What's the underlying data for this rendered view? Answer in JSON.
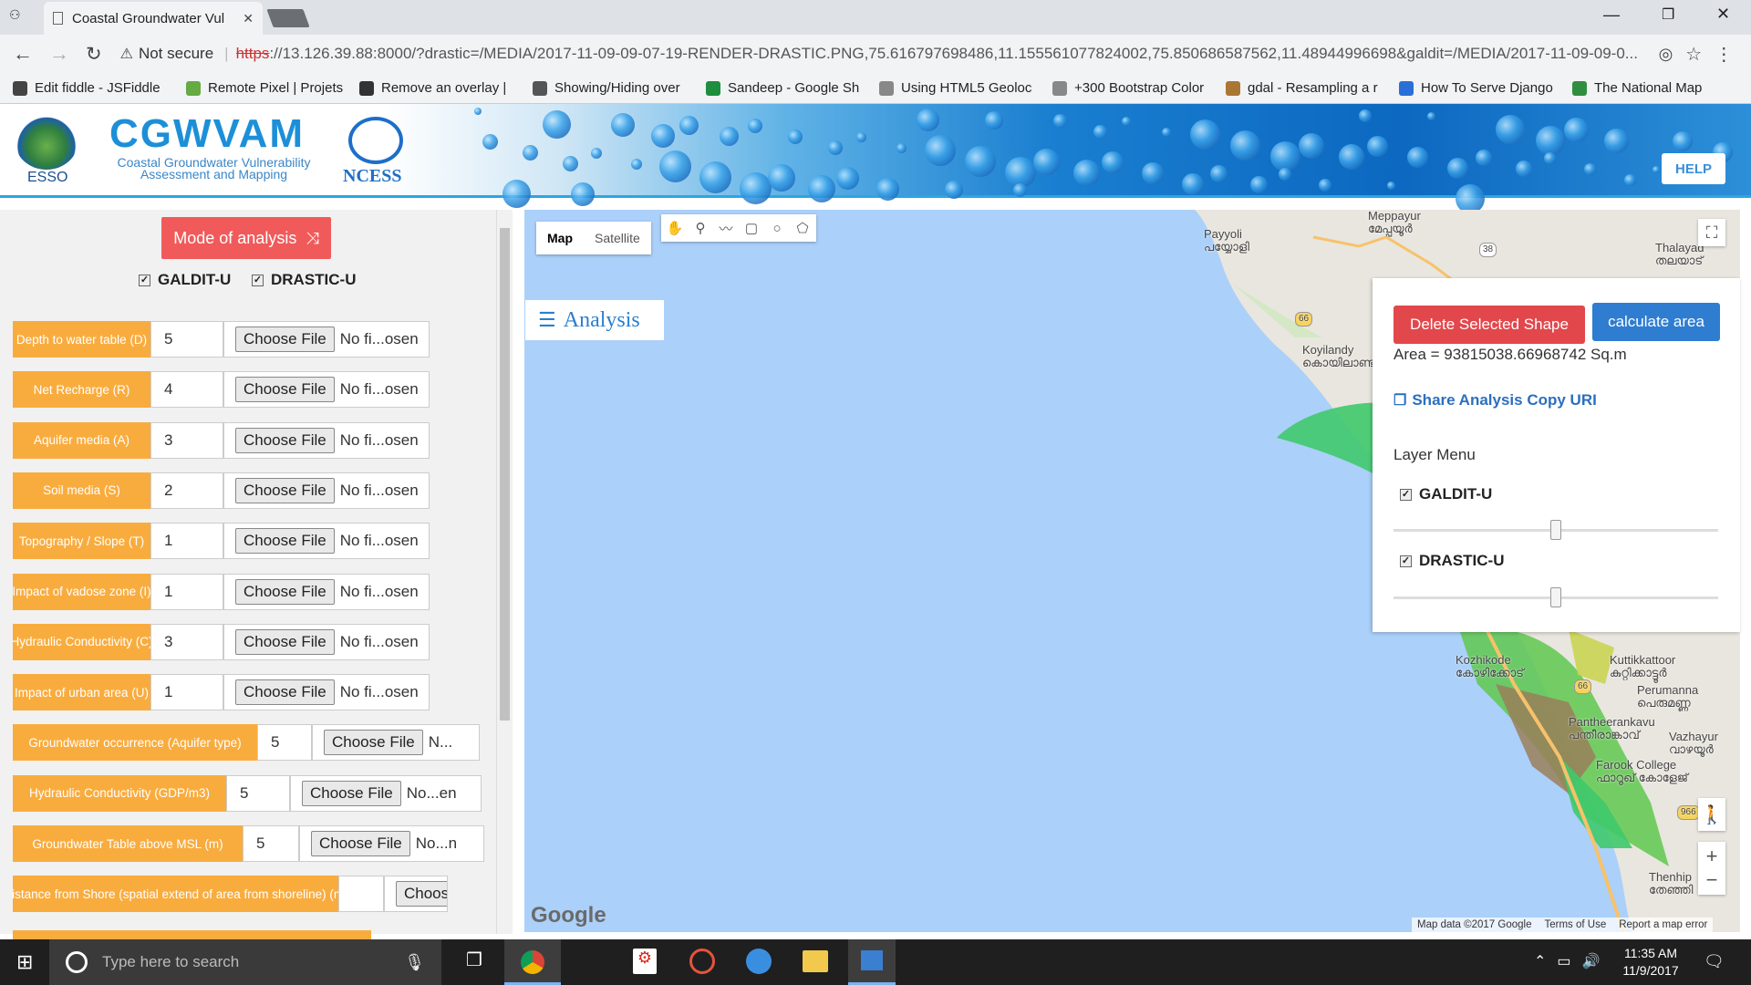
{
  "browser": {
    "tab_title": "Coastal Groundwater Vul",
    "security": "Not secure",
    "url_scheme": "https",
    "url_rest": "://13.126.39.88:8000/?drastic=/MEDIA/2017-11-09-09-07-19-RENDER-DRASTIC.PNG,75.616797698486,11.155561077824002,75.850686587562,11.48944996698&galdit=/MEDIA/2017-11-09-09-0...",
    "bookmarks": [
      {
        "label": "Edit fiddle - JSFiddle",
        "color": "#444"
      },
      {
        "label": "Remote Pixel | Projets",
        "color": "#6a4"
      },
      {
        "label": "Remove an overlay |",
        "color": "#333"
      },
      {
        "label": "Showing/Hiding over",
        "color": "#555"
      },
      {
        "label": "Sandeep - Google Sh",
        "color": "#1e8e3e"
      },
      {
        "label": "Using HTML5 Geoloc",
        "color": "#888"
      },
      {
        "label": "+300 Bootstrap Color",
        "color": "#888"
      },
      {
        "label": "gdal - Resampling a r",
        "color": "#aa7733"
      },
      {
        "label": "How To Serve Django",
        "color": "#2a6fd6"
      },
      {
        "label": "The National Map",
        "color": "#2f8f3f"
      }
    ]
  },
  "header": {
    "esso": "ESSO",
    "title": "CGWVAM",
    "subtitle1": "Coastal Groundwater Vulnerability",
    "subtitle2": "Assessment and Mapping",
    "ncess": "NCESS",
    "help": "HELP"
  },
  "left_panel": {
    "mode_button": "Mode of analysis",
    "check_galdit": "GALDIT-U",
    "check_drastic": "DRASTIC-U",
    "choose_file": "Choose File",
    "rows": [
      {
        "label": "Depth to water table (D)",
        "value": "5",
        "file": "No fi...osen"
      },
      {
        "label": "Net Recharge (R)",
        "value": "4",
        "file": "No fi...osen"
      },
      {
        "label": "Aquifer media (A)",
        "value": "3",
        "file": "No fi...osen"
      },
      {
        "label": "Soil media (S)",
        "value": "2",
        "file": "No fi...osen"
      },
      {
        "label": "Topography / Slope (T)",
        "value": "1",
        "file": "No fi...osen"
      },
      {
        "label": "Impact of vadose zone (I)",
        "value": "1",
        "file": "No fi...osen"
      },
      {
        "label": "Hydraulic Conductivity (C)",
        "value": "3",
        "file": "No fi...osen"
      },
      {
        "label": "Impact of urban area (U)",
        "value": "1",
        "file": "No fi...osen"
      },
      {
        "label": "Groundwater occurrence (Aquifer type)",
        "value": "5",
        "file": "N..."
      },
      {
        "label": "Hydraulic Conductivity (GDP/m3)",
        "value": "5",
        "file": "No...en"
      },
      {
        "label": "Groundwater Table above MSL (m)",
        "value": "5",
        "file": "No...n"
      },
      {
        "label": "Distance from Shore (spatial extend of area from shoreline) (m)",
        "value": "",
        "file": "Choos"
      }
    ]
  },
  "map": {
    "type_map": "Map",
    "type_satellite": "Satellite",
    "analysis_button": "Analysis",
    "towns": [
      {
        "name": "Payyoli",
        "local": "പയ്യോളി"
      },
      {
        "name": "Meppayur",
        "local": "മേപ്പയൂർ"
      },
      {
        "name": "Thalayad",
        "local": "തലയാട്"
      },
      {
        "name": "Koyilandy",
        "local": "കൊയിലാണ്ടി"
      },
      {
        "name": "Kozhikode",
        "local": "കോഴിക്കോട്"
      },
      {
        "name": "Kuttikkattoor",
        "local": "കുറ്റിക്കാട്ടൂർ"
      },
      {
        "name": "Perumanna",
        "local": "പെരുമണ്ണ"
      },
      {
        "name": "Pantheerankavu",
        "local": "പന്തീരാങ്കാവ്"
      },
      {
        "name": "Vazhayur",
        "local": "വാഴയൂർ"
      },
      {
        "name": "Farook College",
        "local": "ഫാറൂഖ് കോളേജ്"
      },
      {
        "name": "Thenhip",
        "local": "തേഞ്ഞി"
      }
    ],
    "roads": [
      "38",
      "66",
      "66",
      "966"
    ],
    "google": "Google",
    "footer_data": "Map data ©2017 Google",
    "footer_terms": "Terms of Use",
    "footer_report": "Report a map error"
  },
  "analysis_panel": {
    "delete_button": "Delete Selected Shape",
    "calculate_button": "calculate area",
    "area_text": "Area = 93815038.66968742 Sq.m",
    "share_link": "Share Analysis Copy URI",
    "layer_menu": "Layer Menu",
    "layer1": "GALDIT-U",
    "layer2": "DRASTIC-U",
    "layer1_opacity": 0.5,
    "layer2_opacity": 0.5
  },
  "taskbar": {
    "search_placeholder": "Type here to search",
    "time": "11:35 AM",
    "date": "11/9/2017"
  }
}
